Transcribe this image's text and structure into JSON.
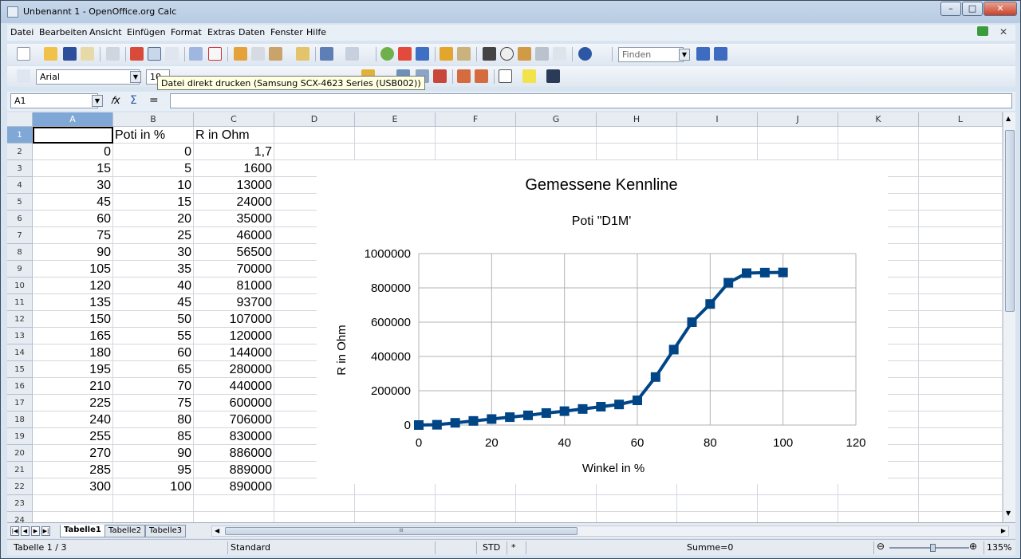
{
  "window": {
    "title": "Unbenannt 1 - OpenOffice.org Calc",
    "minimize": "–",
    "maximize": "□",
    "close": "✕"
  },
  "menu": [
    "Datei",
    "Bearbeiten",
    "Ansicht",
    "Einfügen",
    "Format",
    "Extras",
    "Daten",
    "Fenster",
    "Hilfe"
  ],
  "toolbar": {
    "find_placeholder": "Finden",
    "font_name": "Arial",
    "font_size": "10",
    "tooltip": "Datei direkt drucken (Samsung SCX-4623 Series (USB002))"
  },
  "formula": {
    "cell_ref": "A1",
    "content": ""
  },
  "columns": [
    "A",
    "B",
    "C",
    "D",
    "E",
    "F",
    "G",
    "H",
    "I",
    "J",
    "K",
    "L"
  ],
  "rows": [
    "1",
    "2",
    "3",
    "4",
    "5",
    "6",
    "7",
    "8",
    "9",
    "10",
    "11",
    "12",
    "13",
    "14",
    "15",
    "16",
    "17",
    "18",
    "19",
    "20",
    "21",
    "22",
    "23",
    "24"
  ],
  "cells": {
    "header": [
      "",
      "Poti in %",
      "R in Ohm"
    ],
    "data": [
      [
        "0",
        "0",
        "1,7"
      ],
      [
        "15",
        "5",
        "1600"
      ],
      [
        "30",
        "10",
        "13000"
      ],
      [
        "45",
        "15",
        "24000"
      ],
      [
        "60",
        "20",
        "35000"
      ],
      [
        "75",
        "25",
        "46000"
      ],
      [
        "90",
        "30",
        "56500"
      ],
      [
        "105",
        "35",
        "70000"
      ],
      [
        "120",
        "40",
        "81000"
      ],
      [
        "135",
        "45",
        "93700"
      ],
      [
        "150",
        "50",
        "107000"
      ],
      [
        "165",
        "55",
        "120000"
      ],
      [
        "180",
        "60",
        "144000"
      ],
      [
        "195",
        "65",
        "280000"
      ],
      [
        "210",
        "70",
        "440000"
      ],
      [
        "225",
        "75",
        "600000"
      ],
      [
        "240",
        "80",
        "706000"
      ],
      [
        "255",
        "85",
        "830000"
      ],
      [
        "270",
        "90",
        "886000"
      ],
      [
        "285",
        "95",
        "889000"
      ],
      [
        "300",
        "100",
        "890000"
      ]
    ]
  },
  "chart_data": {
    "type": "line",
    "title": "Gemessene Kennline",
    "subtitle": "Poti \"D1M'",
    "xlabel": "Winkel in %",
    "ylabel": "R in Ohm",
    "xlim": [
      0,
      120
    ],
    "ylim": [
      0,
      1000000
    ],
    "xticks": [
      "0",
      "20",
      "40",
      "60",
      "80",
      "100",
      "120"
    ],
    "yticks": [
      "0",
      "200000",
      "400000",
      "600000",
      "800000",
      "1000000"
    ],
    "grid": true,
    "series_color": "#004586",
    "x": [
      0,
      5,
      10,
      15,
      20,
      25,
      30,
      35,
      40,
      45,
      50,
      55,
      60,
      65,
      70,
      75,
      80,
      85,
      90,
      95,
      100
    ],
    "values": [
      1.7,
      1600,
      13000,
      24000,
      35000,
      46000,
      56500,
      70000,
      81000,
      93700,
      107000,
      120000,
      144000,
      280000,
      440000,
      600000,
      706000,
      830000,
      886000,
      889000,
      890000
    ]
  },
  "sheets": {
    "tabs": [
      "Tabelle1",
      "Tabelle2",
      "Tabelle3"
    ],
    "scroll_grip": "III"
  },
  "status": {
    "sheet": "Tabelle 1 / 3",
    "style": "Standard",
    "mode": "STD",
    "modified": "*",
    "sum": "Summe=0",
    "zoom": "135%",
    "zoom_level": 0.54
  }
}
